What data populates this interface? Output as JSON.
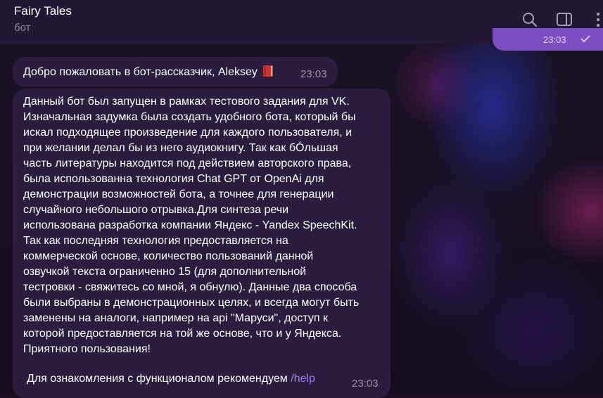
{
  "header": {
    "title": "Fairy Tales",
    "subtitle": "бот",
    "icons": [
      "search-icon",
      "sidebar-panel-icon",
      "more-vertical-icon"
    ]
  },
  "outgoing": {
    "time": "23:03",
    "status_icon": "check-icon",
    "color": "#7c4ec2"
  },
  "messages": [
    {
      "text": "Добро пожаловать в бот-рассказчик, Aleksey",
      "emoji_icon": "red-book-icon",
      "time": "23:03"
    },
    {
      "lines": [
        "Данный бот был запущен в рамках тестового задания для VK.",
        "Изначальная задумка была создать удобного бота, который бы",
        "искал подходящее произведение для каждого пользователя, и",
        "при желании делал бы из него аудиокнигу. Так как бÓльшая",
        "часть литературы находится под действием авторского права,",
        "была использованна технология Chat GPT от OpenAi для",
        "демонстрации возможностей бота, а точнее для генерации",
        "случайного небольшого отрывка.Для синтеза речи",
        "использована разработка компании Яндекс - Yandex SpeechKit.",
        "Так как последняя технология предоставляется на",
        "коммерческой основе, количество пользований данной",
        "озвучкой текста ограниченно 15 (для дополнительной",
        "тестровки - свяжитесь со мной, я обнулю). Данные два способа",
        "были выбраны в демонстрационных целях, и всегда могут быть",
        "заменены на аналоги, например на api \"Маруси\", доступ к",
        "которой предоставляется на той же основе, что и у Яндекса.",
        "Приятного пользования!"
      ],
      "footer_text": "Для ознакомления с функционалом рекомендуем ",
      "command": "/help",
      "time": "23:03"
    }
  ],
  "colors": {
    "header_bg": "#221833",
    "bubble_bg": "#2b1d3e",
    "command_link": "#a27cf0",
    "time_text": "#9a8fb0"
  }
}
